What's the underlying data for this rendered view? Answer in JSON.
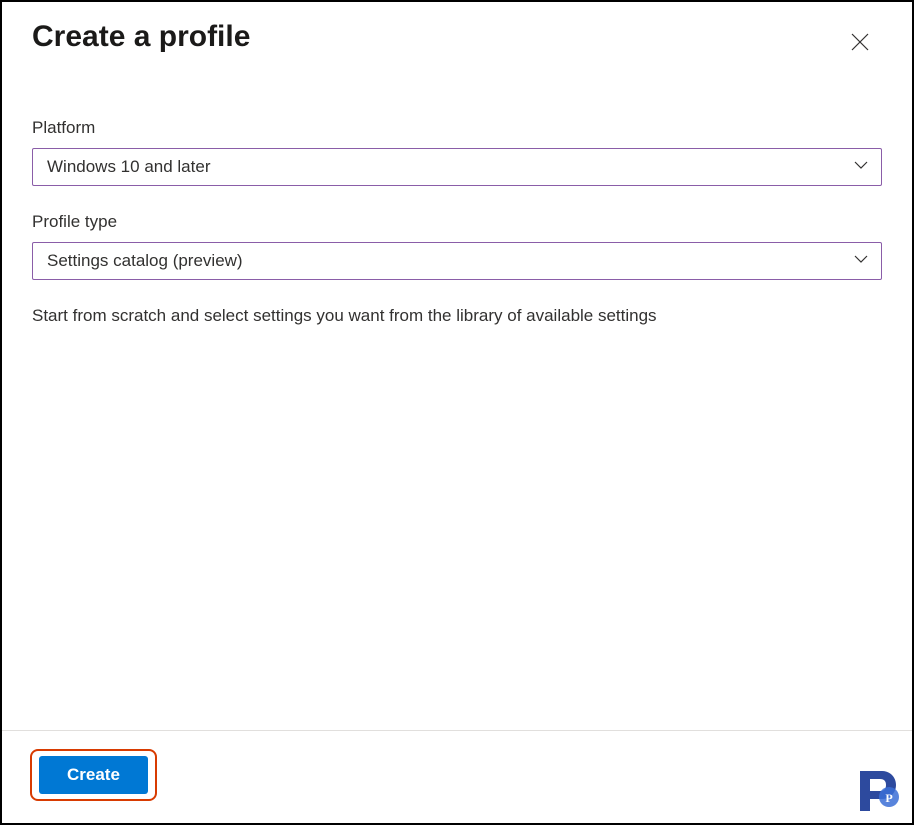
{
  "header": {
    "title": "Create a profile"
  },
  "form": {
    "platform": {
      "label": "Platform",
      "value": "Windows 10 and later"
    },
    "profile_type": {
      "label": "Profile type",
      "value": "Settings catalog (preview)"
    },
    "description": "Start from scratch and select settings you want from the library of available settings"
  },
  "footer": {
    "create_label": "Create"
  }
}
